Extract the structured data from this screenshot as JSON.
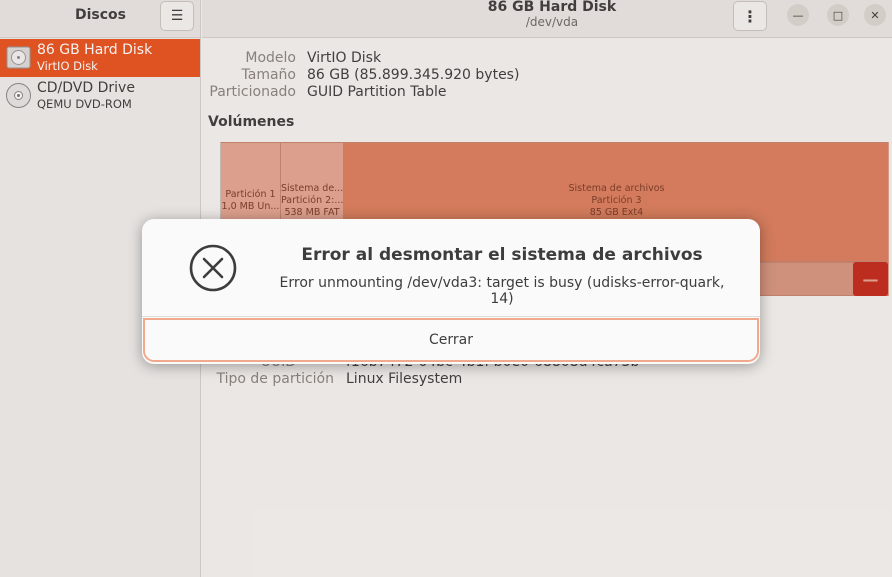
{
  "sidebar": {
    "title": "Discos",
    "disks": [
      {
        "name": "86 GB Hard Disk",
        "sub": "VirtIO Disk"
      },
      {
        "name": "CD/DVD Drive",
        "sub": "QEMU DVD-ROM"
      }
    ]
  },
  "header": {
    "title": "86 GB Hard Disk",
    "subtitle": "/dev/vda"
  },
  "disk_info": {
    "model_label": "Modelo",
    "model_value": "VirtIO Disk",
    "size_label": "Tamaño",
    "size_value": "86 GB (85.899.345.920 bytes)",
    "partitioning_label": "Particionado",
    "partitioning_value": "GUID Partition Table"
  },
  "volumes": {
    "title": "Volúmenes",
    "partitions": [
      {
        "line1": "Partición 1",
        "line2": "1,0 MB Un..."
      },
      {
        "line1": "Sistema de...",
        "line2": "Partición 2:...",
        "line3": "538 MB FAT"
      },
      {
        "line1": "Sistema de archivos",
        "line2": "Partición 3",
        "line3": "85 GB Ext4"
      }
    ]
  },
  "partition_details": {
    "uuid_label": "UUID",
    "uuid_value": "f16b7472-64bc-4b1f-b0e0-68808d4ca73b",
    "type_label": "Tipo de partición",
    "type_value": "Linux Filesystem"
  },
  "dialog": {
    "title": "Error al desmontar el sistema de archivos",
    "message": "Error unmounting /dev/vda3: target is busy (udisks-error-quark, 14)",
    "close_label": "Cerrar"
  },
  "colors": {
    "accent": "#e95420",
    "danger": "#c01c28"
  },
  "icons": {
    "menu": "hamburger-icon",
    "error": "error-circle-x-icon",
    "disk": "hard-disk-icon",
    "cd": "optical-disc-icon"
  }
}
